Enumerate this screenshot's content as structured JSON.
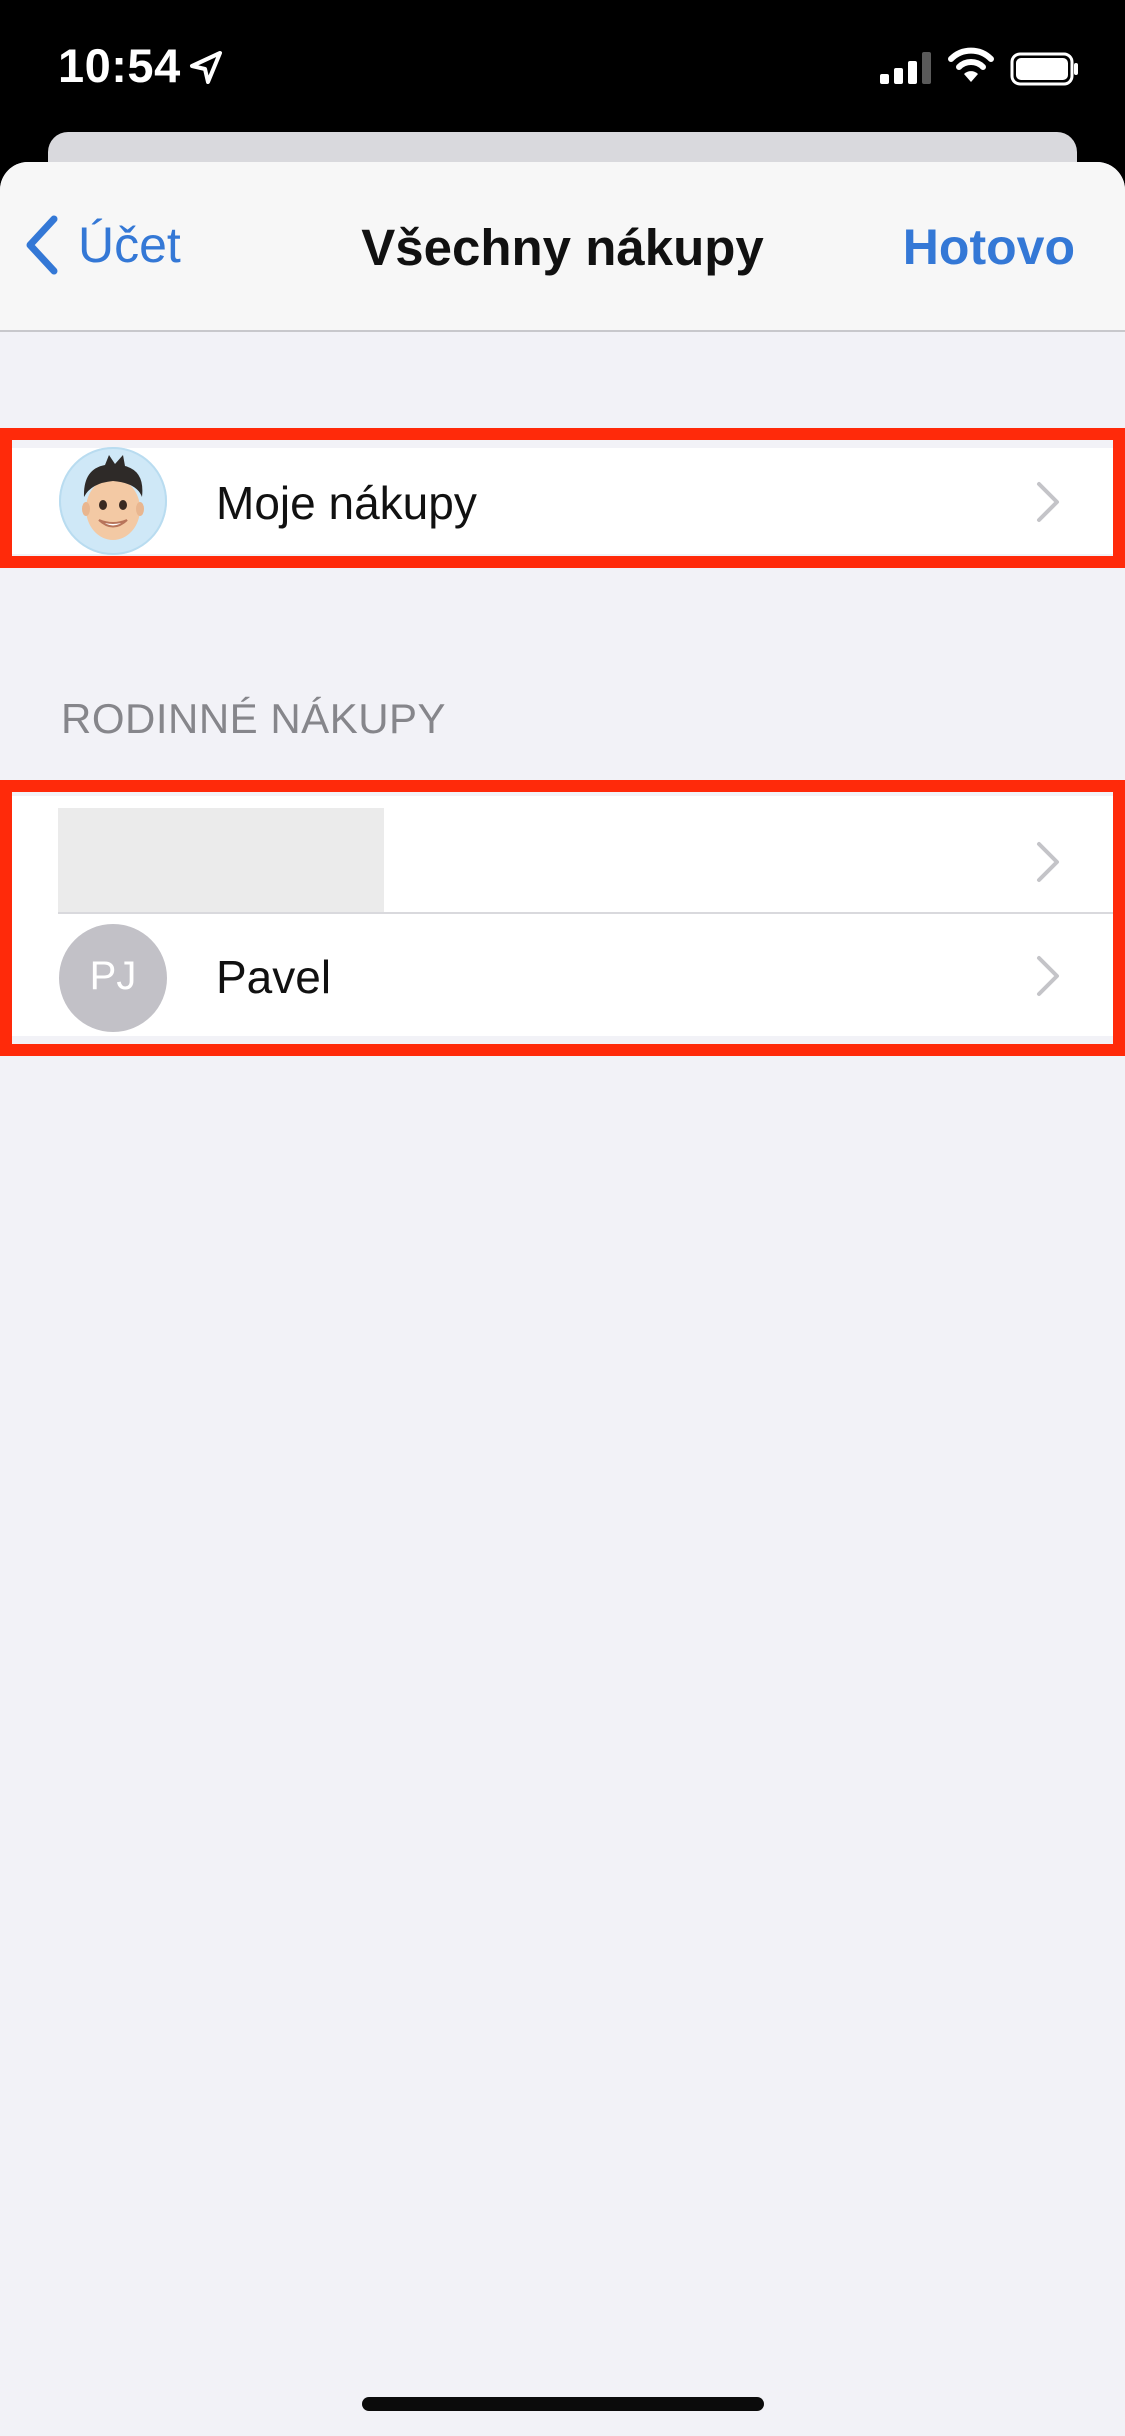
{
  "status_bar": {
    "time": "10:54"
  },
  "nav": {
    "back_label": "Účet",
    "title": "Všechny nákupy",
    "done_label": "Hotovo"
  },
  "my_purchases": {
    "label": "Moje nákupy"
  },
  "family_section": {
    "header": "RODINNÉ NÁKUPY",
    "members": [
      {
        "label": "",
        "initials": ""
      },
      {
        "label": "Pavel",
        "initials": "PJ"
      }
    ]
  },
  "colors": {
    "accent": "#3478d6",
    "highlight": "#ff2a0a",
    "background": "#f2f2f7"
  }
}
